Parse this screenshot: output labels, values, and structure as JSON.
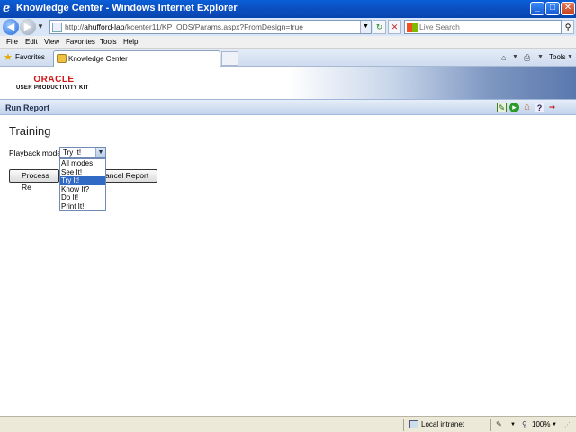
{
  "window": {
    "title": "Knowledge Center - Windows Internet Explorer",
    "minimize": "_",
    "maximize": "□",
    "close": "✕"
  },
  "address_bar": {
    "url_prefix": "http://",
    "url_host": "ahufford-lap",
    "url_path": "/kcenter11/KP_ODS/Params.aspx?FromDesign=true",
    "search_placeholder": "Live Search"
  },
  "menu": [
    "File",
    "Edit",
    "View",
    "Favorites",
    "Tools",
    "Help"
  ],
  "favorites_bar": {
    "favorites_label": "Favorites",
    "tab_label": "Knowledge Center",
    "tools_label": "Tools"
  },
  "banner": {
    "logo_text": "ORACLE",
    "product_text": "USER PRODUCTIVITY KIT"
  },
  "report_bar": {
    "title": "Run Report"
  },
  "content": {
    "heading": "Training",
    "playback_label": "Playback mode",
    "selected_value": "Try It!",
    "process_button": "Process Re",
    "cancel_button": "ancel Report",
    "options": [
      "All modes",
      "See It!",
      "Try It!",
      "Know It?",
      "Do It!",
      "Print It!"
    ],
    "selected_index": 2
  },
  "status_bar": {
    "zone": "Local intranet",
    "zoom": "100%"
  },
  "icons": {
    "back": "back-arrow-icon",
    "forward": "forward-arrow-icon",
    "refresh": "refresh-icon",
    "stop": "stop-icon",
    "search": "search-icon",
    "home": "home-icon",
    "print": "print-icon"
  }
}
